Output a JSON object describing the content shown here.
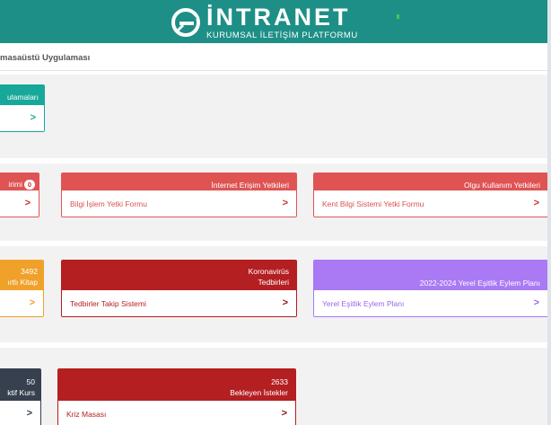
{
  "header": {
    "logo_title": "İNTRANET",
    "logo_subtitle": "KURUMSAL İLETİŞİM PLATFORMU"
  },
  "breadcrumb": "masaüstü Uygulaması",
  "cards": {
    "r1c1": {
      "title": "ulamaları",
      "label": "",
      "color": "#17a89a"
    },
    "r2c1": {
      "title": "irimi",
      "badge": "0",
      "label": "",
      "color": "#df5353"
    },
    "r2c2": {
      "title": "İnternet Erişim Yetkileri",
      "label": "Bilgi İşlem Yetki Formu",
      "color": "#df5353"
    },
    "r2c3": {
      "title": "Olgu Kullanım Yetkileri",
      "label": "Kent Bilgi Sistemi Yetki Formu",
      "color": "#df5353"
    },
    "r3c1": {
      "title_line1": "3492",
      "title_line2": "ırtlı Kitap",
      "label": "",
      "color": "#f0a12a"
    },
    "r3c2": {
      "title_line1": "Koronavirüs",
      "title_line2": "Tedbirleri",
      "label": "Tedbirler Takip Sistemi",
      "color": "#b41f22"
    },
    "r3c3": {
      "title": "2022-2024 Yerel Eşitlik Eylem Planı",
      "label": "Yerel Eşitlik Eylem Planı",
      "color": "#a97af4"
    },
    "r4c1": {
      "title_line1": "50",
      "title_line2": "ktif Kurs",
      "label": "",
      "color": "#36404f"
    },
    "r4c2": {
      "title_line1": "2633",
      "title_line2": "Bekleyen İstekler",
      "label": "Kriz Masası",
      "color": "#b41f22"
    }
  },
  "icons": {
    "arrow": "›",
    "logo": "intranet-logo-icon",
    "chevron": "chevron-right-icon"
  },
  "arrow_glyph": ">"
}
